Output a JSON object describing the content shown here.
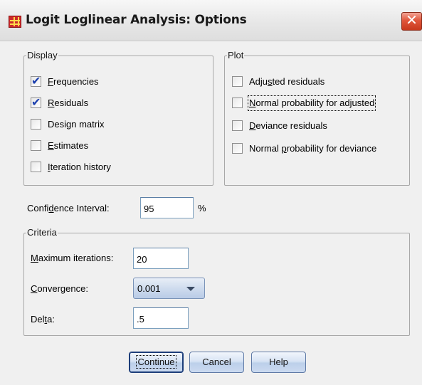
{
  "window": {
    "title": "Logit Loglinear Analysis: Options",
    "close_glyph": "✕",
    "title_icon": "spss-table-icon"
  },
  "display": {
    "legend": "Display",
    "items": [
      {
        "label_pre": "",
        "label_u": "F",
        "label_post": "requencies",
        "checked": true
      },
      {
        "label_pre": "",
        "label_u": "R",
        "label_post": "esiduals",
        "checked": true
      },
      {
        "label_pre": "Desi",
        "label_u": "g",
        "label_post": "n matrix",
        "checked": false
      },
      {
        "label_pre": "",
        "label_u": "E",
        "label_post": "stimates",
        "checked": false
      },
      {
        "label_pre": "",
        "label_u": "I",
        "label_post": "teration history",
        "checked": false
      }
    ]
  },
  "plot": {
    "legend": "Plot",
    "items": [
      {
        "label_pre": "Adju",
        "label_u": "s",
        "label_post": "ted residuals",
        "checked": false
      },
      {
        "label_pre": "",
        "label_u": "N",
        "label_post": "ormal probability for adjusted",
        "checked": false
      },
      {
        "label_pre": "",
        "label_u": "D",
        "label_post": "eviance residuals",
        "checked": false
      },
      {
        "label_pre": "Normal ",
        "label_u": "p",
        "label_post": "robability for deviance",
        "checked": false
      }
    ]
  },
  "confidence": {
    "label_pre": "Confi",
    "label_u": "d",
    "label_post": "ence Interval:",
    "value": "95",
    "unit": "%"
  },
  "criteria": {
    "legend": "Criteria",
    "max_iter": {
      "label_pre": "",
      "label_u": "M",
      "label_post": "aximum iterations:",
      "value": "20"
    },
    "convergence": {
      "label_pre": "",
      "label_u": "C",
      "label_post": "onvergence:",
      "value": "0.001"
    },
    "delta": {
      "label_pre": "Del",
      "label_u": "t",
      "label_post": "a:",
      "value": ".5"
    }
  },
  "buttons": {
    "continue": "Continue",
    "cancel": "Cancel",
    "help": "Help"
  },
  "colors": {
    "dialog_bg": "#f0f0f0",
    "check_color": "#1b3fae",
    "close_red": "#e0563b"
  }
}
